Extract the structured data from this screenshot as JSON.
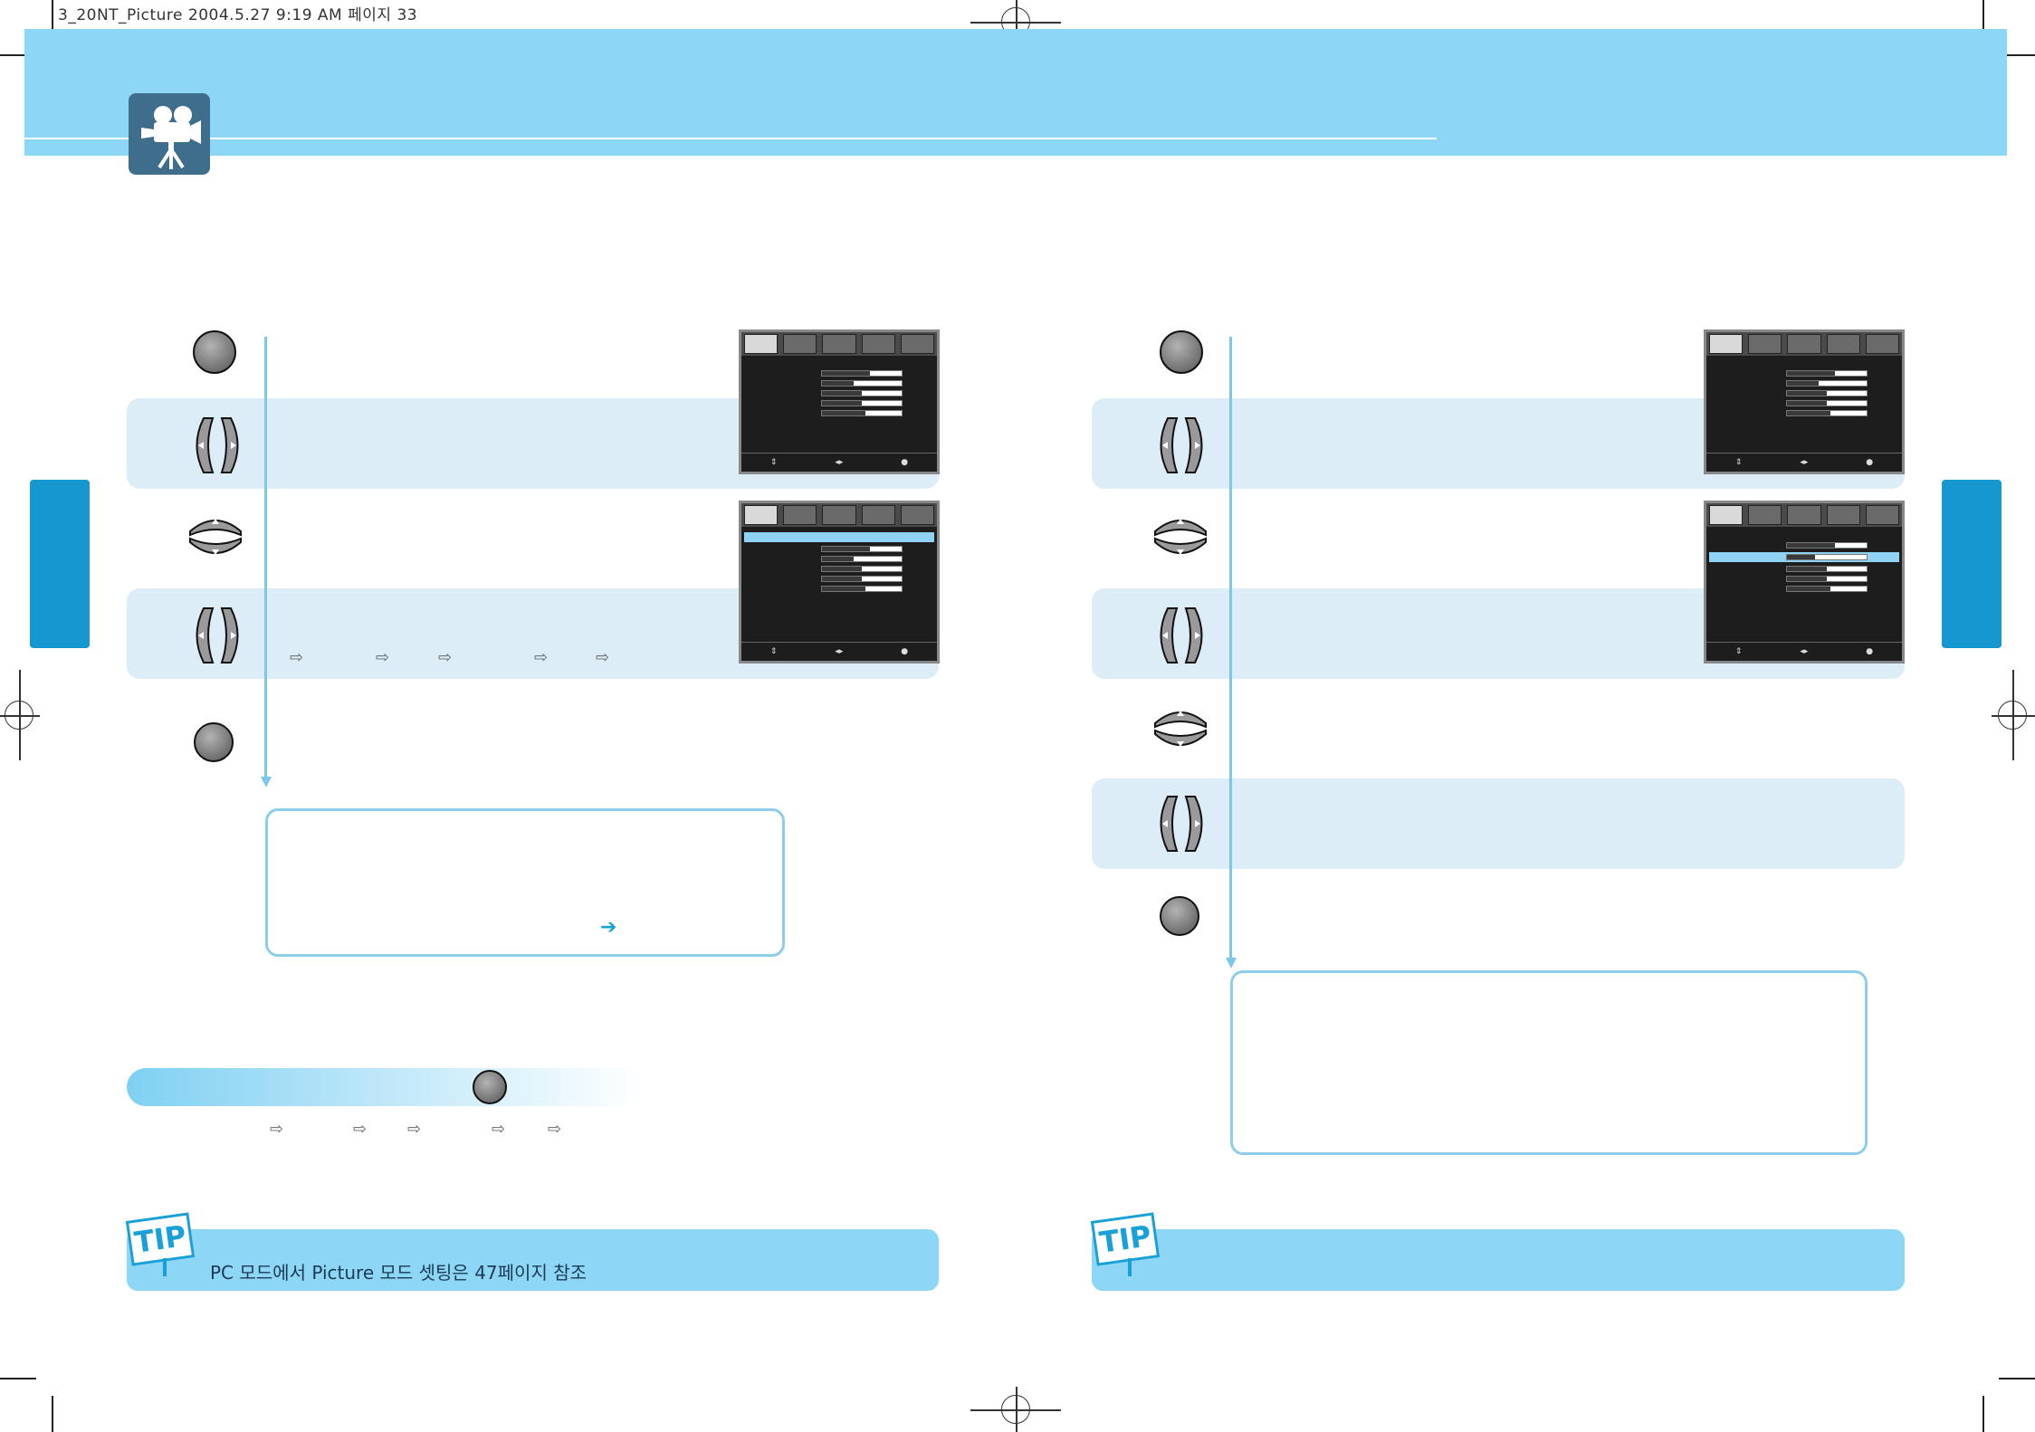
{
  "slug_line": "3_20NT_Picture 2004.5.27 9:19 AM 페이지 33",
  "icons": {
    "header": "video-camera-icon",
    "menu_button": "round-button-icon",
    "left_right_key": "left-right-key-icon",
    "up_down_key": "up-down-key-icon",
    "tip": "tip-sign-icon",
    "next": "next-arrow-icon"
  },
  "colors": {
    "header_band": "#8ed6f5",
    "side_tab": "#1797cf",
    "step_band": "#dcedf7",
    "flow_line": "#7cc7ea",
    "tip_band": "#8ed6f5",
    "note_border": "#8ecde9"
  },
  "tips": {
    "left_text": "PC 모드에서 Picture 모드 셋팅은 47페이지 참조",
    "right_text": "",
    "sign_label": "TIP"
  }
}
